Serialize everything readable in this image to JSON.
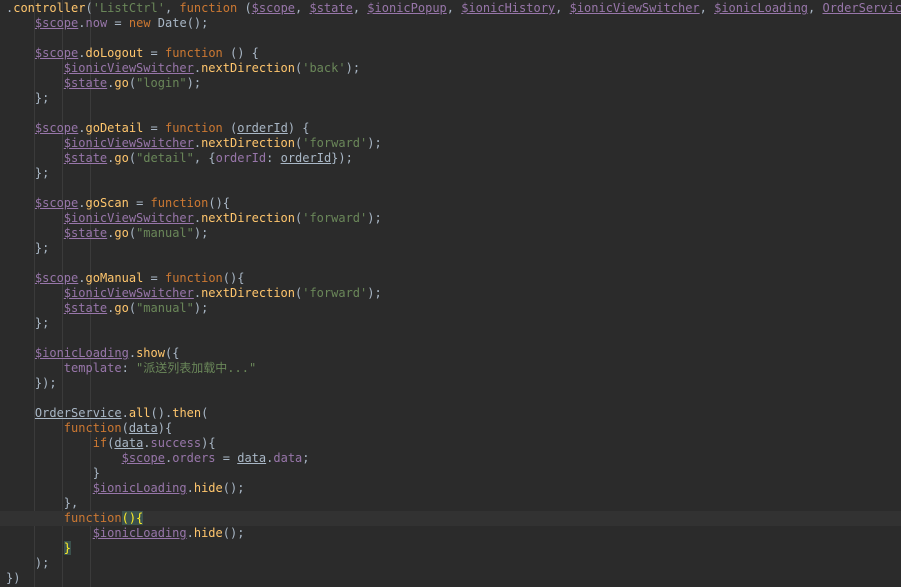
{
  "editor": {
    "colors": {
      "background": "#2b2b2b",
      "current_line": "#323232",
      "keyword": "#cc7832",
      "string": "#6a8759",
      "variable": "#9876aa",
      "function": "#ffc66d",
      "default": "#a9b7c6"
    },
    "lines": [
      [
        [
          ".",
          "punc"
        ],
        [
          "controller",
          "fn"
        ],
        [
          "(",
          "punc"
        ],
        [
          "'ListCtrl'",
          "str"
        ],
        [
          ", ",
          "punc"
        ],
        [
          "function",
          "kw"
        ],
        [
          " (",
          "punc"
        ],
        [
          "$scope",
          "var"
        ],
        [
          ", ",
          "punc"
        ],
        [
          "$state",
          "var"
        ],
        [
          ", ",
          "punc"
        ],
        [
          "$ionicPopup",
          "var"
        ],
        [
          ", ",
          "punc"
        ],
        [
          "$ionicHistory",
          "var"
        ],
        [
          ", ",
          "punc"
        ],
        [
          "$ionicViewSwitcher",
          "var"
        ],
        [
          ", ",
          "punc"
        ],
        [
          "$ionicLoading",
          "var"
        ],
        [
          ", ",
          "punc"
        ],
        [
          "OrderService",
          "var"
        ],
        [
          ") {",
          "punc"
        ]
      ],
      [
        [
          "    ",
          "punc"
        ],
        [
          "$scope",
          "var"
        ],
        [
          ".",
          "punc"
        ],
        [
          "now",
          "prop"
        ],
        [
          " = ",
          "punc"
        ],
        [
          "new ",
          "kw"
        ],
        [
          "Date",
          "punc"
        ],
        [
          "();",
          "punc"
        ]
      ],
      [
        [
          "",
          "punc"
        ]
      ],
      [
        [
          "    ",
          "punc"
        ],
        [
          "$scope",
          "var"
        ],
        [
          ".",
          "punc"
        ],
        [
          "doLogout",
          "fn"
        ],
        [
          " = ",
          "punc"
        ],
        [
          "function",
          "kw"
        ],
        [
          " () {",
          "punc"
        ]
      ],
      [
        [
          "        ",
          "punc"
        ],
        [
          "$ionicViewSwitcher",
          "var"
        ],
        [
          ".",
          "punc"
        ],
        [
          "nextDirection",
          "fn"
        ],
        [
          "(",
          "punc"
        ],
        [
          "'back'",
          "str"
        ],
        [
          ");",
          "punc"
        ]
      ],
      [
        [
          "        ",
          "punc"
        ],
        [
          "$state",
          "var"
        ],
        [
          ".",
          "punc"
        ],
        [
          "go",
          "fn"
        ],
        [
          "(",
          "punc"
        ],
        [
          "\"login\"",
          "str"
        ],
        [
          ");",
          "punc"
        ]
      ],
      [
        [
          "    ",
          "punc"
        ],
        [
          "};",
          "punc"
        ]
      ],
      [
        [
          "",
          "punc"
        ]
      ],
      [
        [
          "    ",
          "punc"
        ],
        [
          "$scope",
          "var"
        ],
        [
          ".",
          "punc"
        ],
        [
          "goDetail",
          "fn"
        ],
        [
          " = ",
          "punc"
        ],
        [
          "function",
          "kw"
        ],
        [
          " (",
          "punc"
        ],
        [
          "orderId",
          "obj"
        ],
        [
          ") {",
          "punc"
        ]
      ],
      [
        [
          "        ",
          "punc"
        ],
        [
          "$ionicViewSwitcher",
          "var"
        ],
        [
          ".",
          "punc"
        ],
        [
          "nextDirection",
          "fn"
        ],
        [
          "(",
          "punc"
        ],
        [
          "'forward'",
          "str"
        ],
        [
          ");",
          "punc"
        ]
      ],
      [
        [
          "        ",
          "punc"
        ],
        [
          "$state",
          "var"
        ],
        [
          ".",
          "punc"
        ],
        [
          "go",
          "fn"
        ],
        [
          "(",
          "punc"
        ],
        [
          "\"detail\"",
          "str"
        ],
        [
          ", {",
          "punc"
        ],
        [
          "orderId",
          "prop"
        ],
        [
          ": ",
          "punc"
        ],
        [
          "orderId",
          "obj"
        ],
        [
          "});",
          "punc"
        ]
      ],
      [
        [
          "    ",
          "punc"
        ],
        [
          "};",
          "punc"
        ]
      ],
      [
        [
          "",
          "punc"
        ]
      ],
      [
        [
          "    ",
          "punc"
        ],
        [
          "$scope",
          "var"
        ],
        [
          ".",
          "punc"
        ],
        [
          "goScan",
          "fn"
        ],
        [
          " = ",
          "punc"
        ],
        [
          "function",
          "kw"
        ],
        [
          "(){",
          "punc"
        ]
      ],
      [
        [
          "        ",
          "punc"
        ],
        [
          "$ionicViewSwitcher",
          "var"
        ],
        [
          ".",
          "punc"
        ],
        [
          "nextDirection",
          "fn"
        ],
        [
          "(",
          "punc"
        ],
        [
          "'forward'",
          "str"
        ],
        [
          ");",
          "punc"
        ]
      ],
      [
        [
          "        ",
          "punc"
        ],
        [
          "$state",
          "var"
        ],
        [
          ".",
          "punc"
        ],
        [
          "go",
          "fn"
        ],
        [
          "(",
          "punc"
        ],
        [
          "\"manual\"",
          "str"
        ],
        [
          ");",
          "punc"
        ]
      ],
      [
        [
          "    ",
          "punc"
        ],
        [
          "};",
          "punc"
        ]
      ],
      [
        [
          "",
          "punc"
        ]
      ],
      [
        [
          "    ",
          "punc"
        ],
        [
          "$scope",
          "var"
        ],
        [
          ".",
          "punc"
        ],
        [
          "goManual",
          "fn"
        ],
        [
          " = ",
          "punc"
        ],
        [
          "function",
          "kw"
        ],
        [
          "(){",
          "punc"
        ]
      ],
      [
        [
          "        ",
          "punc"
        ],
        [
          "$ionicViewSwitcher",
          "var"
        ],
        [
          ".",
          "punc"
        ],
        [
          "nextDirection",
          "fn"
        ],
        [
          "(",
          "punc"
        ],
        [
          "'forward'",
          "str"
        ],
        [
          ");",
          "punc"
        ]
      ],
      [
        [
          "        ",
          "punc"
        ],
        [
          "$state",
          "var"
        ],
        [
          ".",
          "punc"
        ],
        [
          "go",
          "fn"
        ],
        [
          "(",
          "punc"
        ],
        [
          "\"manual\"",
          "str"
        ],
        [
          ");",
          "punc"
        ]
      ],
      [
        [
          "    ",
          "punc"
        ],
        [
          "};",
          "punc"
        ]
      ],
      [
        [
          "",
          "punc"
        ]
      ],
      [
        [
          "    ",
          "punc"
        ],
        [
          "$ionicLoading",
          "var"
        ],
        [
          ".",
          "punc"
        ],
        [
          "show",
          "fn"
        ],
        [
          "({",
          "punc"
        ]
      ],
      [
        [
          "        ",
          "punc"
        ],
        [
          "template",
          "prop"
        ],
        [
          ": ",
          "punc"
        ],
        [
          "\"派送列表加载中...\"",
          "str"
        ]
      ],
      [
        [
          "    ",
          "punc"
        ],
        [
          "});",
          "punc"
        ]
      ],
      [
        [
          "",
          "punc"
        ]
      ],
      [
        [
          "    ",
          "punc"
        ],
        [
          "OrderService",
          "obj"
        ],
        [
          ".",
          "punc"
        ],
        [
          "all",
          "fn"
        ],
        [
          "().",
          "punc"
        ],
        [
          "then",
          "fn"
        ],
        [
          "(",
          "punc"
        ]
      ],
      [
        [
          "        ",
          "punc"
        ],
        [
          "function",
          "kw"
        ],
        [
          "(",
          "punc"
        ],
        [
          "data",
          "obj"
        ],
        [
          "){",
          "punc"
        ]
      ],
      [
        [
          "            ",
          "punc"
        ],
        [
          "if",
          "kw"
        ],
        [
          "(",
          "punc"
        ],
        [
          "data",
          "obj"
        ],
        [
          ".",
          "punc"
        ],
        [
          "success",
          "prop"
        ],
        [
          "){",
          "punc"
        ]
      ],
      [
        [
          "                ",
          "punc"
        ],
        [
          "$scope",
          "var"
        ],
        [
          ".",
          "punc"
        ],
        [
          "orders",
          "prop"
        ],
        [
          " = ",
          "punc"
        ],
        [
          "data",
          "obj"
        ],
        [
          ".",
          "punc"
        ],
        [
          "data",
          "prop"
        ],
        [
          ";",
          "punc"
        ]
      ],
      [
        [
          "            ",
          "punc"
        ],
        [
          "}",
          "punc"
        ]
      ],
      [
        [
          "            ",
          "punc"
        ],
        [
          "$ionicLoading",
          "var"
        ],
        [
          ".",
          "punc"
        ],
        [
          "hide",
          "fn"
        ],
        [
          "();",
          "punc"
        ]
      ],
      [
        [
          "        ",
          "punc"
        ],
        [
          "},",
          "punc"
        ]
      ],
      [
        [
          "        ",
          "punc"
        ],
        [
          "function",
          "kw"
        ],
        [
          "()",
          "paren-hl"
        ],
        [
          "{",
          "brace-hl"
        ]
      ],
      [
        [
          "            ",
          "punc"
        ],
        [
          "$ionicLoading",
          "var"
        ],
        [
          ".",
          "punc"
        ],
        [
          "hide",
          "fn"
        ],
        [
          "();",
          "punc"
        ]
      ],
      [
        [
          "        ",
          "punc"
        ],
        [
          "}",
          "brace-hl"
        ]
      ],
      [
        [
          "    ",
          "punc"
        ],
        [
          ");",
          "punc"
        ]
      ],
      [
        [
          "})",
          "punc"
        ]
      ]
    ],
    "current_line_index": 34
  }
}
